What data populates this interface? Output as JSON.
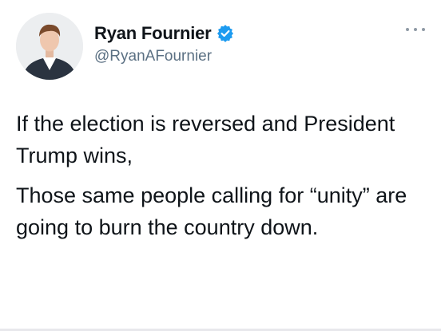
{
  "author": {
    "display_name": "Ryan Fournier",
    "handle": "@RyanAFournier",
    "verified": true
  },
  "icons": {
    "verified": "verified-badge-icon",
    "more": "more-options-icon"
  },
  "colors": {
    "verified_blue": "#1d9bf0",
    "text": "#0f1419",
    "muted": "#5b7083"
  },
  "tweet": {
    "paragraph_1": "If the election is reversed and President Trump wins,",
    "paragraph_2": "Those same people calling for “unity” are going to burn the country down."
  }
}
